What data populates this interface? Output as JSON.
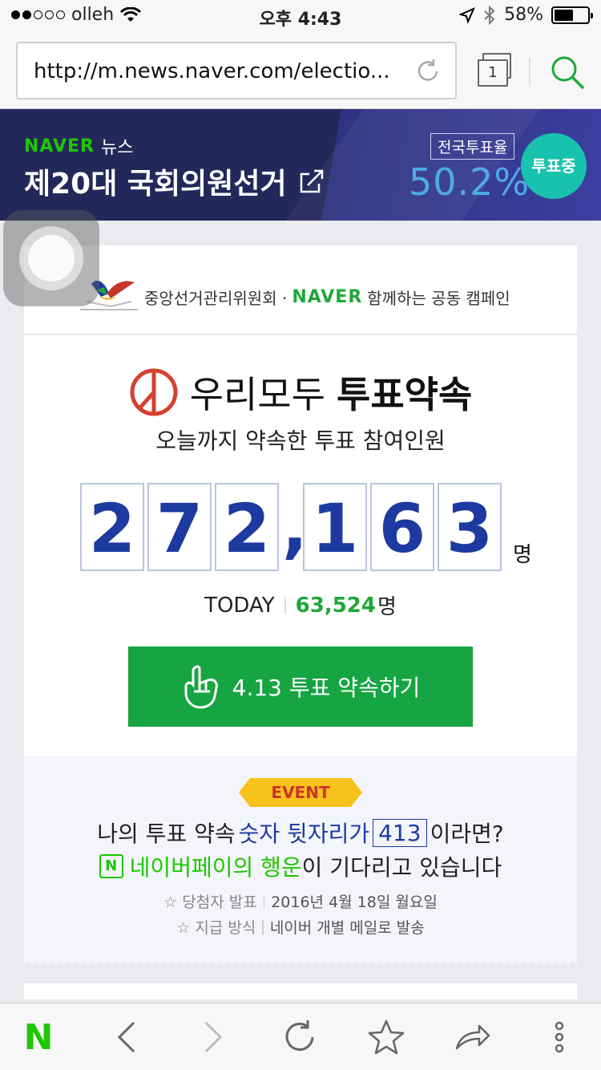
{
  "status": {
    "carrier": "olleh",
    "time": "오후 4:43",
    "battery": "58%",
    "battery_level": 0.58
  },
  "browser": {
    "url": "http://m.news.naver.com/electio...",
    "tab_count": "1"
  },
  "banner": {
    "brand": "NAVER",
    "section": "뉴스",
    "title": "제20대 국회의원선거",
    "turnout_label": "전국투표율",
    "turnout_value": "50.2%",
    "voting_badge": "투표중"
  },
  "card": {
    "partner_org": "중앙선거관리위원회 ·",
    "partner_brand": "NAVER",
    "partner_suffix": "함께하는 공동 캠페인",
    "title_normal": "우리모두",
    "title_bold": "투표약속",
    "subtitle": "오늘까지 약속한 투표 참여인원",
    "count_digits": [
      "2",
      "7",
      "2",
      ",",
      "1",
      "6",
      "3"
    ],
    "count_unit": "명",
    "today_label": "TODAY",
    "today_value": "63,524",
    "today_unit": "명",
    "button_label": "4.13 투표 약속하기"
  },
  "event": {
    "ribbon": "EVENT",
    "line1_pre": "나의 투표 약속",
    "line1_hl": "숫자 뒷자리가",
    "line1_box": "413",
    "line1_post": "이라면?",
    "line2_icon": "N",
    "line2_hl": "네이버페이의 행운",
    "line2_post": "이 기다리고 있습니다",
    "info1_key": "☆ 당첨자 발표",
    "info1_val": "2016년 4월 18일 월요일",
    "info2_key": "☆ 지급 방식",
    "info2_val": "네이버 개별 메일로 발송"
  },
  "toolbar": {
    "home": "N"
  },
  "colors": {
    "naver_green": "#1ec800",
    "button_green": "#16a542",
    "counter_blue": "#1d3aa0",
    "banner_navy": "#23285a",
    "badge_teal": "#19c2ae"
  }
}
